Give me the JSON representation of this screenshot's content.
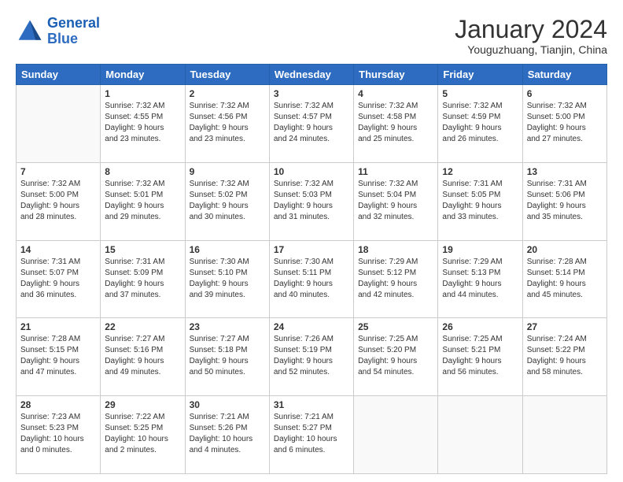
{
  "logo": {
    "line1": "General",
    "line2": "Blue"
  },
  "title": "January 2024",
  "subtitle": "Youguzhuang, Tianjin, China",
  "days_of_week": [
    "Sunday",
    "Monday",
    "Tuesday",
    "Wednesday",
    "Thursday",
    "Friday",
    "Saturday"
  ],
  "weeks": [
    [
      {
        "day": "",
        "content": ""
      },
      {
        "day": "1",
        "content": "Sunrise: 7:32 AM\nSunset: 4:55 PM\nDaylight: 9 hours\nand 23 minutes."
      },
      {
        "day": "2",
        "content": "Sunrise: 7:32 AM\nSunset: 4:56 PM\nDaylight: 9 hours\nand 23 minutes."
      },
      {
        "day": "3",
        "content": "Sunrise: 7:32 AM\nSunset: 4:57 PM\nDaylight: 9 hours\nand 24 minutes."
      },
      {
        "day": "4",
        "content": "Sunrise: 7:32 AM\nSunset: 4:58 PM\nDaylight: 9 hours\nand 25 minutes."
      },
      {
        "day": "5",
        "content": "Sunrise: 7:32 AM\nSunset: 4:59 PM\nDaylight: 9 hours\nand 26 minutes."
      },
      {
        "day": "6",
        "content": "Sunrise: 7:32 AM\nSunset: 5:00 PM\nDaylight: 9 hours\nand 27 minutes."
      }
    ],
    [
      {
        "day": "7",
        "content": "Sunrise: 7:32 AM\nSunset: 5:00 PM\nDaylight: 9 hours\nand 28 minutes."
      },
      {
        "day": "8",
        "content": "Sunrise: 7:32 AM\nSunset: 5:01 PM\nDaylight: 9 hours\nand 29 minutes."
      },
      {
        "day": "9",
        "content": "Sunrise: 7:32 AM\nSunset: 5:02 PM\nDaylight: 9 hours\nand 30 minutes."
      },
      {
        "day": "10",
        "content": "Sunrise: 7:32 AM\nSunset: 5:03 PM\nDaylight: 9 hours\nand 31 minutes."
      },
      {
        "day": "11",
        "content": "Sunrise: 7:32 AM\nSunset: 5:04 PM\nDaylight: 9 hours\nand 32 minutes."
      },
      {
        "day": "12",
        "content": "Sunrise: 7:31 AM\nSunset: 5:05 PM\nDaylight: 9 hours\nand 33 minutes."
      },
      {
        "day": "13",
        "content": "Sunrise: 7:31 AM\nSunset: 5:06 PM\nDaylight: 9 hours\nand 35 minutes."
      }
    ],
    [
      {
        "day": "14",
        "content": "Sunrise: 7:31 AM\nSunset: 5:07 PM\nDaylight: 9 hours\nand 36 minutes."
      },
      {
        "day": "15",
        "content": "Sunrise: 7:31 AM\nSunset: 5:09 PM\nDaylight: 9 hours\nand 37 minutes."
      },
      {
        "day": "16",
        "content": "Sunrise: 7:30 AM\nSunset: 5:10 PM\nDaylight: 9 hours\nand 39 minutes."
      },
      {
        "day": "17",
        "content": "Sunrise: 7:30 AM\nSunset: 5:11 PM\nDaylight: 9 hours\nand 40 minutes."
      },
      {
        "day": "18",
        "content": "Sunrise: 7:29 AM\nSunset: 5:12 PM\nDaylight: 9 hours\nand 42 minutes."
      },
      {
        "day": "19",
        "content": "Sunrise: 7:29 AM\nSunset: 5:13 PM\nDaylight: 9 hours\nand 44 minutes."
      },
      {
        "day": "20",
        "content": "Sunrise: 7:28 AM\nSunset: 5:14 PM\nDaylight: 9 hours\nand 45 minutes."
      }
    ],
    [
      {
        "day": "21",
        "content": "Sunrise: 7:28 AM\nSunset: 5:15 PM\nDaylight: 9 hours\nand 47 minutes."
      },
      {
        "day": "22",
        "content": "Sunrise: 7:27 AM\nSunset: 5:16 PM\nDaylight: 9 hours\nand 49 minutes."
      },
      {
        "day": "23",
        "content": "Sunrise: 7:27 AM\nSunset: 5:18 PM\nDaylight: 9 hours\nand 50 minutes."
      },
      {
        "day": "24",
        "content": "Sunrise: 7:26 AM\nSunset: 5:19 PM\nDaylight: 9 hours\nand 52 minutes."
      },
      {
        "day": "25",
        "content": "Sunrise: 7:25 AM\nSunset: 5:20 PM\nDaylight: 9 hours\nand 54 minutes."
      },
      {
        "day": "26",
        "content": "Sunrise: 7:25 AM\nSunset: 5:21 PM\nDaylight: 9 hours\nand 56 minutes."
      },
      {
        "day": "27",
        "content": "Sunrise: 7:24 AM\nSunset: 5:22 PM\nDaylight: 9 hours\nand 58 minutes."
      }
    ],
    [
      {
        "day": "28",
        "content": "Sunrise: 7:23 AM\nSunset: 5:23 PM\nDaylight: 10 hours\nand 0 minutes."
      },
      {
        "day": "29",
        "content": "Sunrise: 7:22 AM\nSunset: 5:25 PM\nDaylight: 10 hours\nand 2 minutes."
      },
      {
        "day": "30",
        "content": "Sunrise: 7:21 AM\nSunset: 5:26 PM\nDaylight: 10 hours\nand 4 minutes."
      },
      {
        "day": "31",
        "content": "Sunrise: 7:21 AM\nSunset: 5:27 PM\nDaylight: 10 hours\nand 6 minutes."
      },
      {
        "day": "",
        "content": ""
      },
      {
        "day": "",
        "content": ""
      },
      {
        "day": "",
        "content": ""
      }
    ]
  ]
}
